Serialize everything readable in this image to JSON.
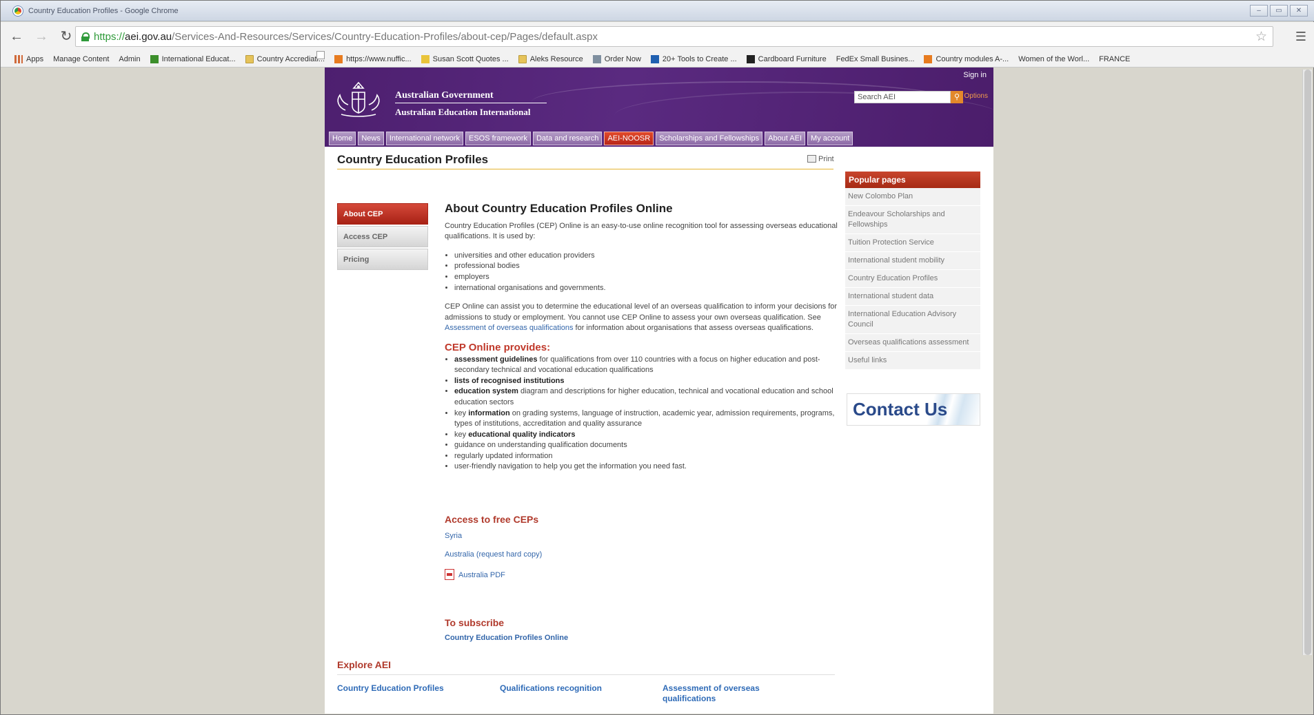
{
  "browser": {
    "window_title": "Country Education Profiles - Google Chrome",
    "url_scheme": "https://",
    "url_host": "aei.gov.au",
    "url_path": "/Services-And-Resources/Services/Country-Education-Profiles/about-cep/Pages/default.aspx",
    "window_controls": [
      "‒",
      "▭",
      "✕"
    ],
    "bookmarks": [
      {
        "label": "Apps",
        "icon": "apps-grid-icon"
      },
      {
        "label": "Manage Content",
        "icon": "page-icon"
      },
      {
        "label": "Admin",
        "icon": "page-icon"
      },
      {
        "label": "International Educat...",
        "icon": "green-site-icon"
      },
      {
        "label": "Country Accrediati...",
        "icon": "folder-icon"
      },
      {
        "label": "https://www.nuffic...",
        "icon": "orange-site-icon"
      },
      {
        "label": "Susan Scott Quotes ...",
        "icon": "yellow-site-icon"
      },
      {
        "label": "Aleks Resource",
        "icon": "folder-icon"
      },
      {
        "label": "Order Now",
        "icon": "grey-site-icon"
      },
      {
        "label": "20+ Tools to Create ...",
        "icon": "blue-site-icon"
      },
      {
        "label": "Cardboard Furniture",
        "icon": "dark-site-icon"
      },
      {
        "label": "FedEx Small Busines...",
        "icon": "page-icon"
      },
      {
        "label": "Country modules A-...",
        "icon": "orange-site-icon"
      },
      {
        "label": "Women of the Worl...",
        "icon": "page-icon"
      },
      {
        "label": "FRANCE",
        "icon": "page-icon"
      }
    ]
  },
  "header": {
    "sign_in": "Sign in",
    "gov_line1": "Australian Government",
    "gov_line2": "Australian Education International",
    "search_placeholder": "Search AEI",
    "options": "Options",
    "nav": [
      "Home",
      "News",
      "International network",
      "ESOS framework",
      "Data and research",
      "AEI-NOOSR",
      "Scholarships and Fellowships",
      "About AEI",
      "My account"
    ],
    "nav_active_index": 5
  },
  "page": {
    "title": "Country Education Profiles",
    "print": "Print"
  },
  "leftnav": [
    "About CEP",
    "Access CEP",
    "Pricing"
  ],
  "content": {
    "heading": "About Country Education Profiles Online",
    "intro": "Country Education Profiles (CEP) Online is an easy-to-use online recognition tool for assessing overseas educational qualifications. It is used by:",
    "users": [
      "universities and other education providers",
      "professional bodies",
      "employers",
      "international organisations and governments."
    ],
    "para2_a": "CEP Online can assist you to determine the educational level of an overseas qualification to inform your decisions for admissions to study or employment. You cannot use CEP Online to assess your own overseas qualification. See ",
    "para2_link": "Assessment of overseas qualifications",
    "para2_b": " for information about organisations that assess overseas qualifications.",
    "provides_heading": "CEP Online provides:",
    "provides": [
      {
        "pre": "",
        "bold": "assessment guidelines",
        "post": " for qualifications from over 110 countries with a focus on higher education and post-secondary technical and vocational education qualifications"
      },
      {
        "pre": "",
        "bold": "lists of recognised institutions",
        "post": ""
      },
      {
        "pre": "",
        "bold": "education system",
        "post": " diagram and descriptions for higher education, technical and vocational education and school education sectors"
      },
      {
        "pre": "key ",
        "bold": "information",
        "post": " on grading systems, language of instruction, academic year, admission requirements, programs, types of institutions, accreditation and quality assurance"
      },
      {
        "pre": "key ",
        "bold": "educational quality indicators",
        "post": ""
      },
      {
        "pre": "guidance on understanding qualification documents",
        "bold": "",
        "post": ""
      },
      {
        "pre": "regularly updated information",
        "bold": "",
        "post": ""
      },
      {
        "pre": "user-friendly navigation to help you get the information you need fast.",
        "bold": "",
        "post": ""
      }
    ],
    "access_heading": "Access to free CEPs",
    "access_links": [
      "Syria",
      "Australia (request hard copy)",
      "Australia PDF"
    ],
    "subscribe_heading": "To subscribe",
    "subscribe_link": "Country Education Profiles Online",
    "explore_heading": "Explore AEI",
    "explore_links": [
      "Country Education Profiles",
      "Qualifications recognition",
      "Assessment of overseas qualifications"
    ]
  },
  "sidebar": {
    "popular_heading": "Popular pages",
    "popular": [
      "New Colombo Plan",
      "Endeavour Scholarships and Fellowships",
      "Tuition Protection Service",
      "International student mobility",
      "Country Education Profiles",
      "International student data",
      "International Education Advisory Council",
      "Overseas qualifications assessment",
      "Useful links"
    ],
    "contact": "Contact Us"
  },
  "colors": {
    "banner_purple": "#4d1f6f",
    "accent_red": "#b0392b",
    "link_blue": "#3366aa",
    "rule_gold": "#e5b431"
  }
}
